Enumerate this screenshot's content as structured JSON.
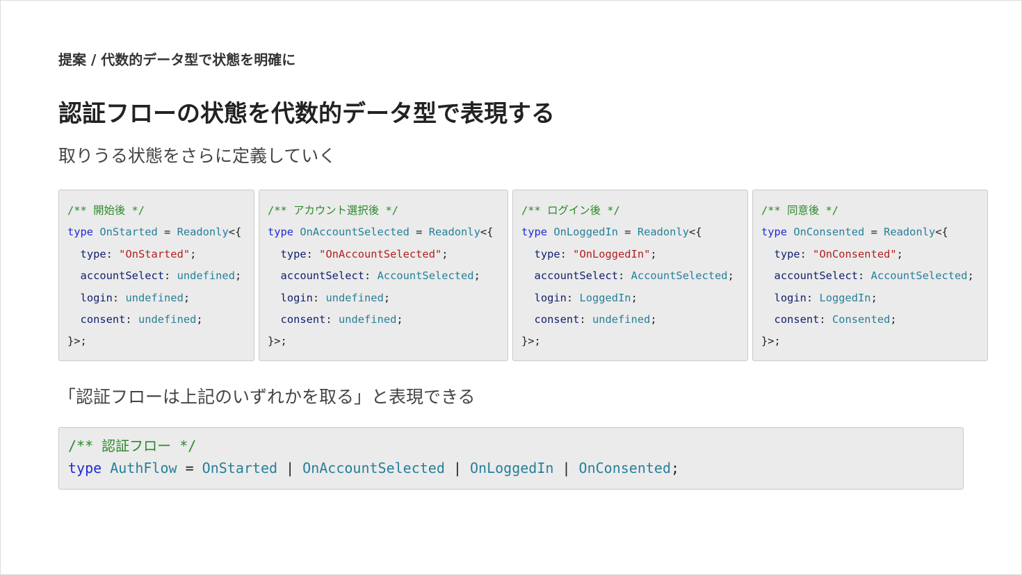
{
  "breadcrumb": "提案 / 代数的データ型で状態を明確に",
  "title": "認証フローの状態を代数的データ型で表現する",
  "subtitle": "取りうる状態をさらに定義していく",
  "note": "「認証フローは上記のいずれかを取る」と表現できる",
  "keywords": {
    "type": "type",
    "readonly": "Readonly",
    "undefined": "undefined"
  },
  "states": [
    {
      "comment": "/** 開始後 */",
      "name": "OnStarted",
      "literal": "\"OnStarted\"",
      "accountSelect": "undefined",
      "login": "undefined",
      "consent": "undefined"
    },
    {
      "comment": "/** アカウント選択後 */",
      "name": "OnAccountSelected",
      "literal": "\"OnAccountSelected\"",
      "accountSelect": "AccountSelected",
      "login": "undefined",
      "consent": "undefined"
    },
    {
      "comment": "/** ログイン後 */",
      "name": "OnLoggedIn",
      "literal": "\"OnLoggedIn\"",
      "accountSelect": "AccountSelected",
      "login": "LoggedIn",
      "consent": "undefined"
    },
    {
      "comment": "/** 同意後 */",
      "name": "OnConsented",
      "literal": "\"OnConsented\"",
      "accountSelect": "AccountSelected",
      "login": "LoggedIn",
      "consent": "Consented"
    }
  ],
  "union": {
    "comment": "/** 認証フロー */",
    "name": "AuthFlow",
    "members": [
      "OnStarted",
      "OnAccountSelected",
      "OnLoggedIn",
      "OnConsented"
    ]
  }
}
